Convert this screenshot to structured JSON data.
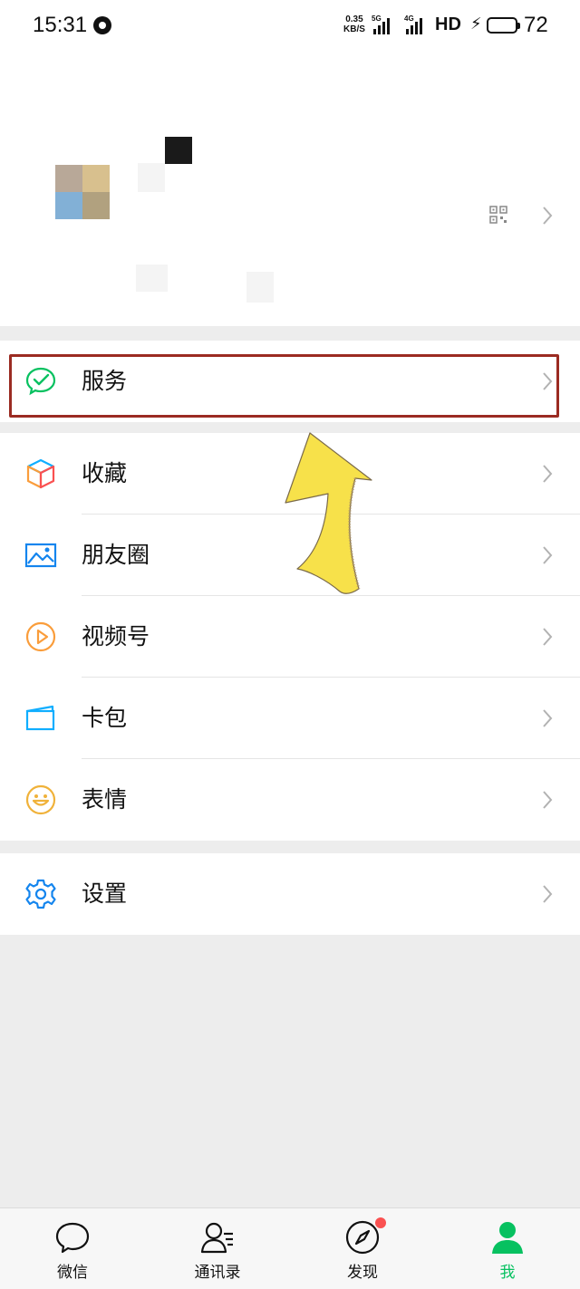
{
  "status_bar": {
    "time": "15:31",
    "net_speed_value": "0.35",
    "net_speed_unit": "KB/S",
    "sim1_tag": "5G",
    "sim2_tag": "4G",
    "hd_label": "HD",
    "battery_percent": "72",
    "battery_level": 0.72
  },
  "profile": {
    "qr_icon": "qr-code-icon",
    "chevron_icon": "chevron-right-icon"
  },
  "menu": {
    "service": {
      "label": "服务",
      "icon": "wechat-pay-icon",
      "color": "#07c160"
    },
    "items": [
      {
        "label": "收藏",
        "icon": "favorites-cube-icon"
      },
      {
        "label": "朋友圈",
        "icon": "moments-picture-icon",
        "color": "#1485ee"
      },
      {
        "label": "视频号",
        "icon": "channels-play-icon",
        "color": "#fa9d3b"
      },
      {
        "label": "卡包",
        "icon": "card-wallet-icon",
        "color": "#10aeff"
      },
      {
        "label": "表情",
        "icon": "sticker-smile-icon",
        "color": "#f0b23a"
      }
    ],
    "settings": {
      "label": "设置",
      "icon": "gear-icon",
      "color": "#1485ee"
    }
  },
  "tabbar": {
    "tabs": [
      {
        "label": "微信",
        "icon": "chat-bubble-icon",
        "active": false
      },
      {
        "label": "通讯录",
        "icon": "contacts-icon",
        "active": false
      },
      {
        "label": "发现",
        "icon": "compass-icon",
        "active": false,
        "badge": true
      },
      {
        "label": "我",
        "icon": "person-icon",
        "active": true
      }
    ],
    "active_color": "#07c160",
    "badge_color": "#fa5151"
  },
  "annotation": {
    "highlight_color": "#9b2b22",
    "arrow_color": "#f7e14a"
  }
}
